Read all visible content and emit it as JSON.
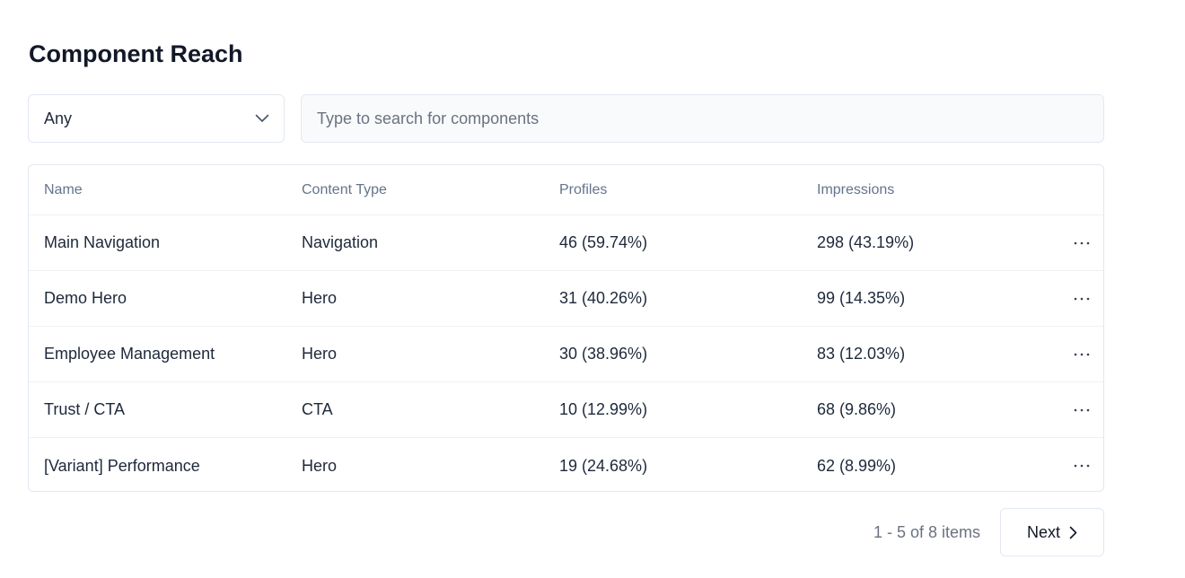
{
  "page": {
    "title": "Component Reach"
  },
  "filters": {
    "type_select": {
      "selected": "Any",
      "icon": "chevron-down-icon"
    },
    "search": {
      "placeholder": "Type to search for components",
      "value": ""
    }
  },
  "table": {
    "columns": [
      "Name",
      "Content Type",
      "Profiles",
      "Impressions"
    ],
    "rows": [
      {
        "name": "Main Navigation",
        "content_type": "Navigation",
        "profiles": "46 (59.74%)",
        "impressions": "298 (43.19%)"
      },
      {
        "name": "Demo Hero",
        "content_type": "Hero",
        "profiles": "31 (40.26%)",
        "impressions": "99 (14.35%)"
      },
      {
        "name": "Employee Management",
        "content_type": "Hero",
        "profiles": "30 (38.96%)",
        "impressions": "83 (12.03%)"
      },
      {
        "name": "Trust / CTA",
        "content_type": "CTA",
        "profiles": "10 (12.99%)",
        "impressions": "68 (9.86%)"
      },
      {
        "name": "[Variant] Performance",
        "content_type": "Hero",
        "profiles": "19 (24.68%)",
        "impressions": "62 (8.99%)"
      }
    ],
    "row_action_icon": "more-horizontal-icon"
  },
  "pagination": {
    "info": "1 - 5 of 8 items",
    "next_label": "Next",
    "next_icon": "chevron-right-icon"
  },
  "colors": {
    "text_primary": "#1e293b",
    "text_muted": "#64748b",
    "border": "#e2e8f0",
    "search_bg": "#f8fafc"
  }
}
